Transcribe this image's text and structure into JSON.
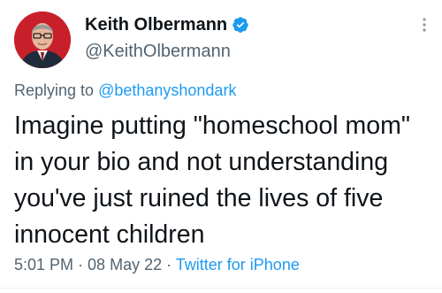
{
  "tweet": {
    "display_name": "Keith Olbermann",
    "handle": "@KeithOlbermann",
    "verified": true,
    "replying_prefix": "Replying to ",
    "replying_to": "@bethanyshondark",
    "text": "Imagine putting \"homeschool mom\" in your bio and not understanding you've just ruined the lives of five innocent children",
    "time": "5:01 PM",
    "separator": " · ",
    "date": "08 May 22",
    "source": "Twitter for iPhone"
  },
  "icons": {
    "verified": "verified-badge-icon",
    "more": "more-options-icon",
    "avatar": "profile-photo"
  },
  "colors": {
    "accent": "#1d9bf0",
    "secondary_text": "#536471",
    "primary_text": "#0f1419",
    "avatar_bg": "#c8202a"
  }
}
